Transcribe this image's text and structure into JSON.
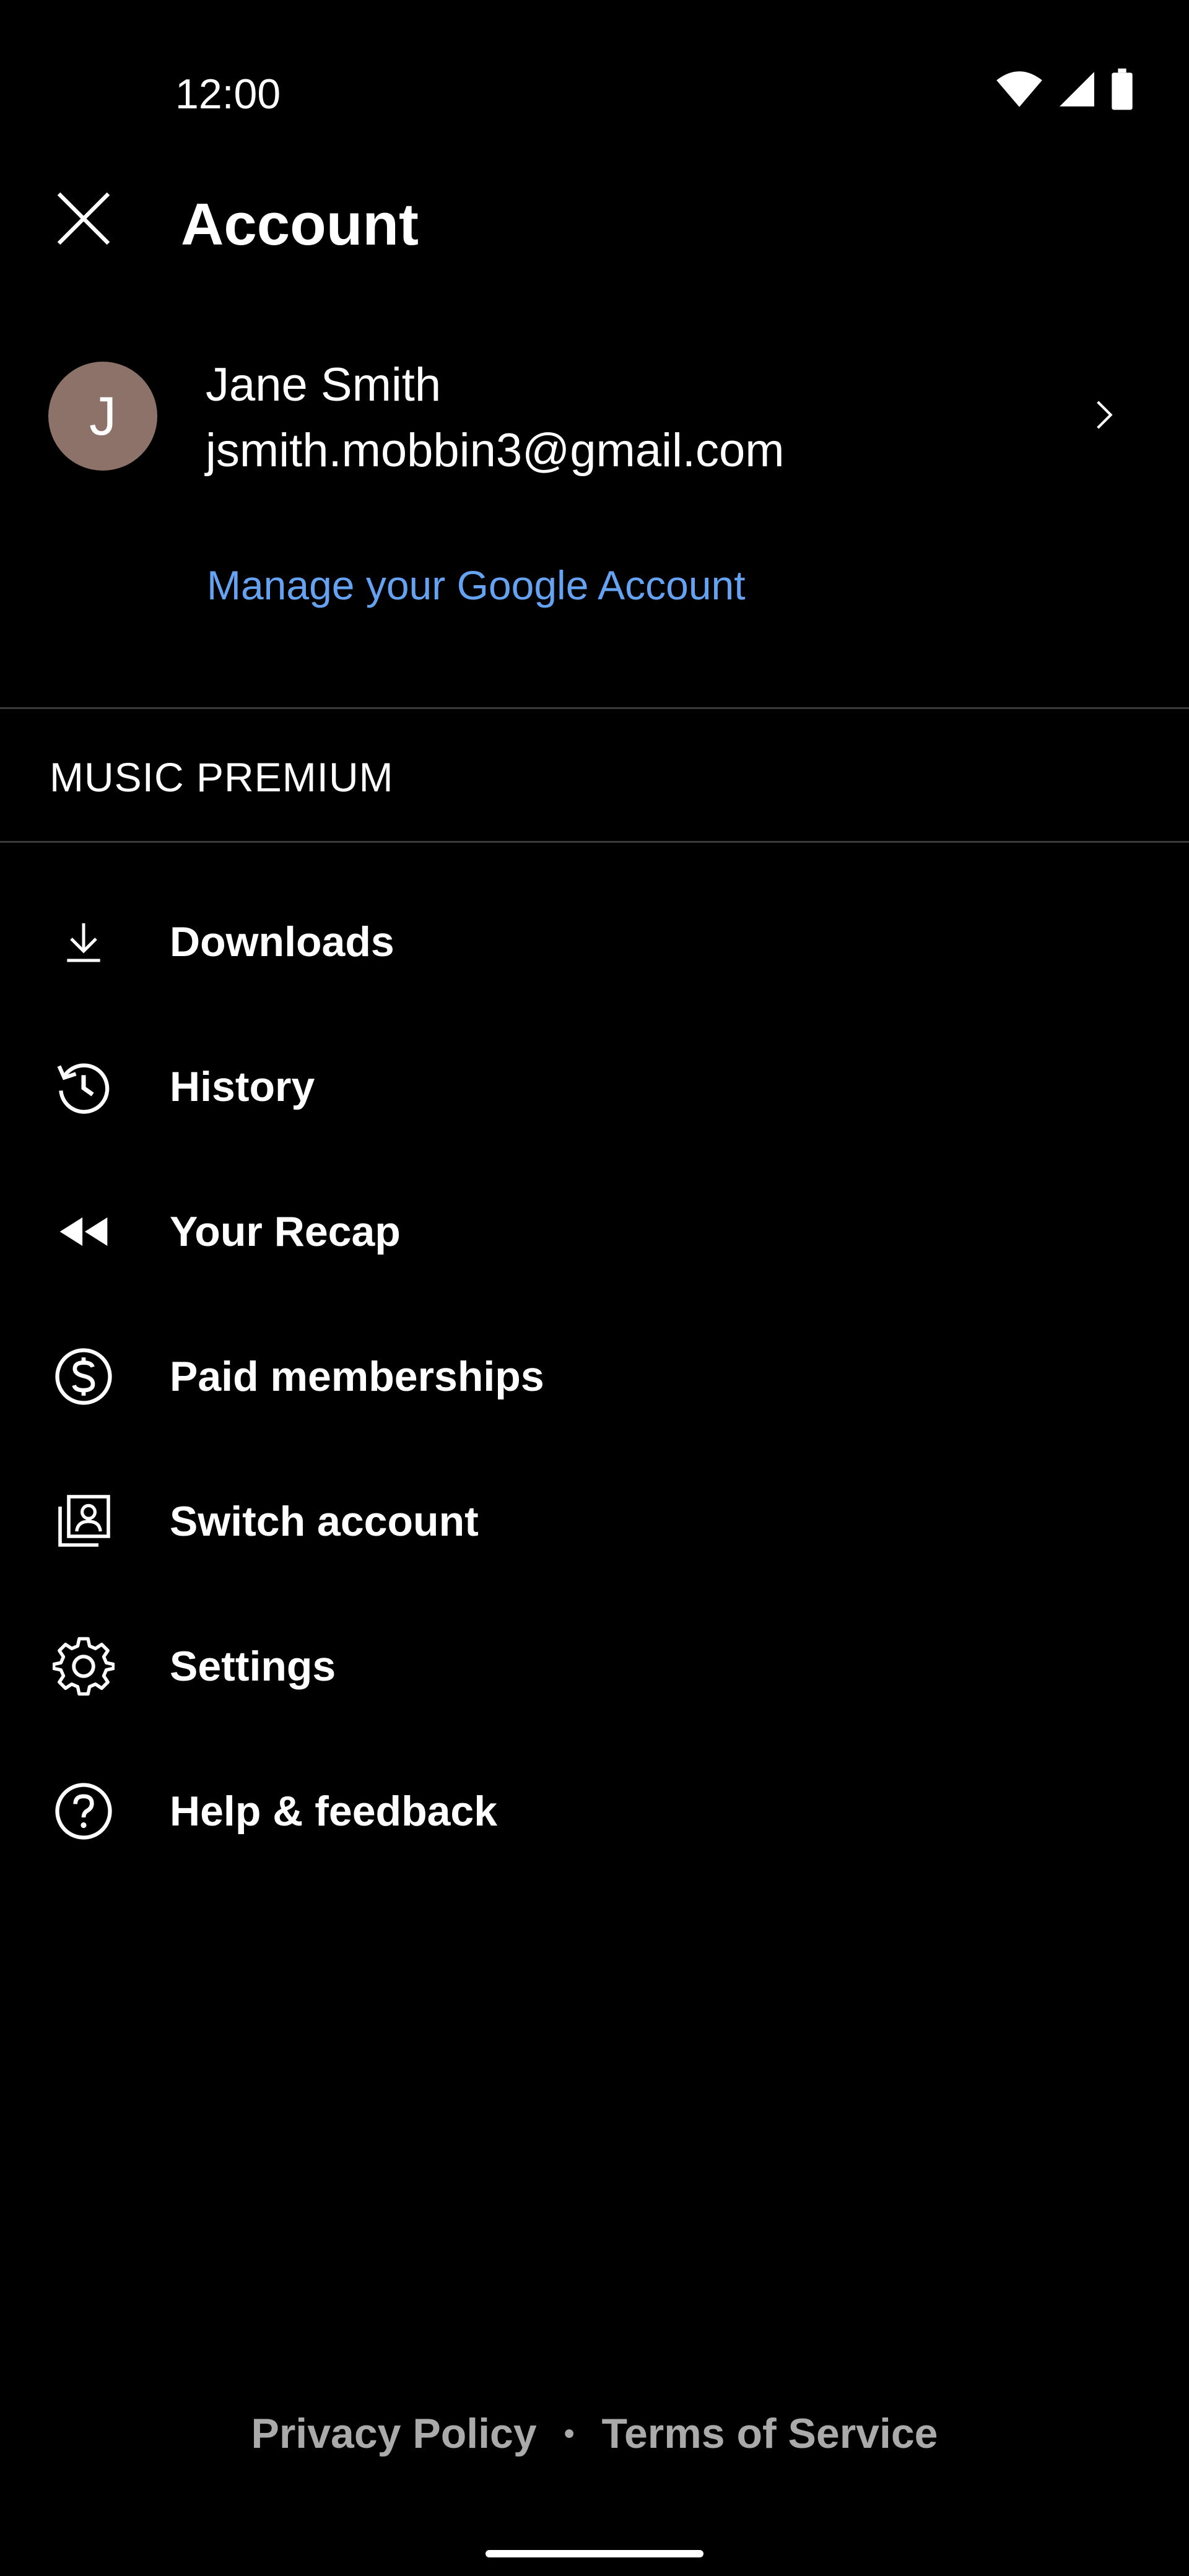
{
  "status_bar": {
    "time": "12:00",
    "icons": [
      "wifi-icon",
      "cellular-signal-icon",
      "battery-icon"
    ]
  },
  "header": {
    "title": "Account",
    "close_icon": "close-icon"
  },
  "account": {
    "avatar_letter": "J",
    "name": "Jane Smith",
    "email": "jsmith.mobbin3@gmail.com",
    "chevron_icon": "chevron-right-icon",
    "manage_link": "Manage your Google Account"
  },
  "section": {
    "label": "MUSIC PREMIUM"
  },
  "menu": {
    "items": [
      {
        "label": "Downloads",
        "icon": "download-icon"
      },
      {
        "label": "History",
        "icon": "history-icon"
      },
      {
        "label": "Your Recap",
        "icon": "rewind-icon"
      },
      {
        "label": "Paid memberships",
        "icon": "dollar-circle-icon"
      },
      {
        "label": "Switch account",
        "icon": "switch-account-icon"
      },
      {
        "label": "Settings",
        "icon": "gear-icon"
      },
      {
        "label": "Help & feedback",
        "icon": "help-circle-icon"
      }
    ]
  },
  "footer": {
    "privacy": "Privacy Policy",
    "separator": "•",
    "terms": "Terms of Service"
  },
  "colors": {
    "background": "#000000",
    "text": "#ffffff",
    "link": "#65a3f2",
    "footer_text": "#aaaaaa",
    "avatar_bg": "#8c7268",
    "divider": "#3a3a3a"
  }
}
